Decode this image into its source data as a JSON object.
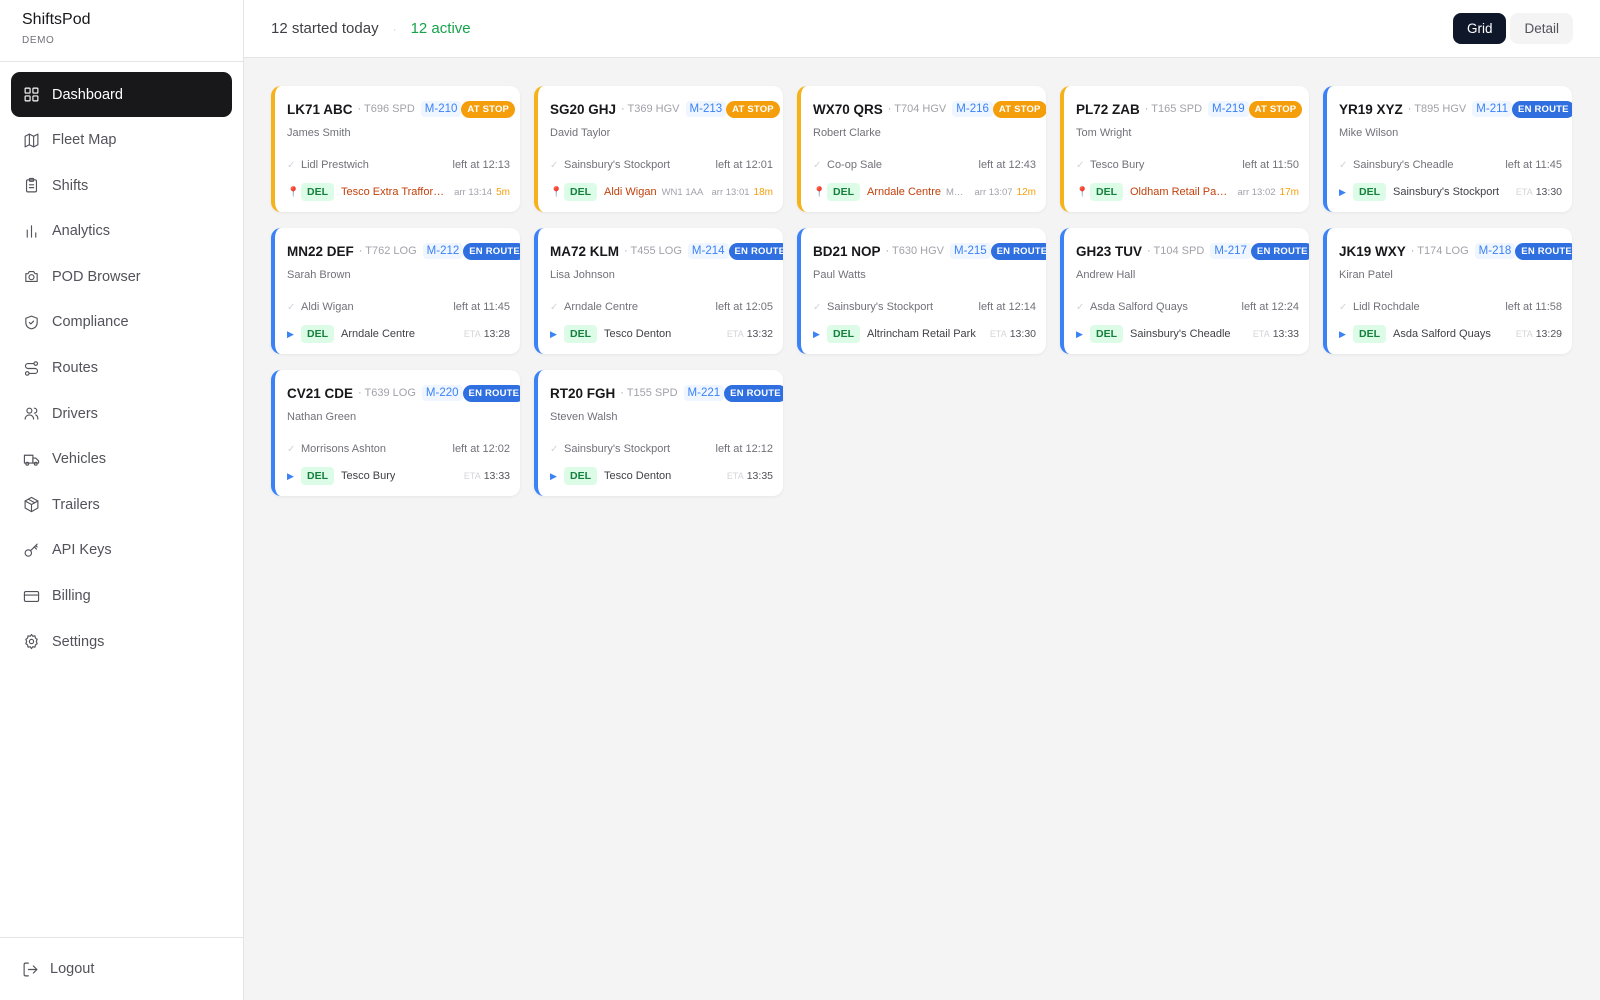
{
  "app": {
    "name": "ShiftsPod",
    "env": "DEMO"
  },
  "nav": {
    "items": [
      {
        "label": "Dashboard",
        "icon": "grid-icon"
      },
      {
        "label": "Fleet Map",
        "icon": "map-icon"
      },
      {
        "label": "Shifts",
        "icon": "clipboard-icon"
      },
      {
        "label": "Analytics",
        "icon": "bar-chart-icon"
      },
      {
        "label": "POD Browser",
        "icon": "camera-icon"
      },
      {
        "label": "Compliance",
        "icon": "shield-check-icon"
      },
      {
        "label": "Routes",
        "icon": "route-icon"
      },
      {
        "label": "Drivers",
        "icon": "users-icon"
      },
      {
        "label": "Vehicles",
        "icon": "truck-icon"
      },
      {
        "label": "Trailers",
        "icon": "box-icon"
      },
      {
        "label": "API Keys",
        "icon": "key-icon"
      },
      {
        "label": "Billing",
        "icon": "credit-card-icon"
      },
      {
        "label": "Settings",
        "icon": "gear-icon"
      }
    ],
    "active": "Dashboard",
    "logout": "Logout"
  },
  "header": {
    "started": "12 started today",
    "separator": "·",
    "active": "12 active",
    "view_grid": "Grid",
    "view_detail": "Detail",
    "selected_view": "Grid"
  },
  "labels": {
    "del": "DEL",
    "eta": "ETA",
    "arr_prefix": "arr"
  },
  "colors": {
    "at_stop": "#f59e0b",
    "en_route": "#2f6fe0",
    "del_badge": "#15803d",
    "active": "#16a34a"
  },
  "cards": [
    {
      "plate": "LK71 ABC",
      "trailer": "· T696 SPD",
      "mission": "M-210",
      "status": "AT STOP",
      "kind": "stop",
      "driver": "James Smith",
      "prev_stop": "Lidl Prestwich",
      "prev_left": "left at 12:13",
      "next_stop": "Tesco Extra Traffor…",
      "postcode": "",
      "arr": "arr 13:14",
      "wait": "5m",
      "eta": ""
    },
    {
      "plate": "SG20 GHJ",
      "trailer": "· T369 HGV",
      "mission": "M-213",
      "status": "AT STOP",
      "kind": "stop",
      "driver": "David Taylor",
      "prev_stop": "Sainsbury's Stockport",
      "prev_left": "left at 12:01",
      "next_stop": "Aldi Wigan",
      "postcode": "WN1 1AA",
      "arr": "arr 13:01",
      "wait": "18m",
      "eta": ""
    },
    {
      "plate": "WX70 QRS",
      "trailer": "· T704 HGV",
      "mission": "M-216",
      "status": "AT STOP",
      "kind": "stop",
      "driver": "Robert Clarke",
      "prev_stop": "Co-op Sale",
      "prev_left": "left at 12:43",
      "next_stop": "Arndale Centre",
      "postcode": "M…",
      "arr": "arr 13:07",
      "wait": "12m",
      "eta": ""
    },
    {
      "plate": "PL72 ZAB",
      "trailer": "· T165 SPD",
      "mission": "M-219",
      "status": "AT STOP",
      "kind": "stop",
      "driver": "Tom Wright",
      "prev_stop": "Tesco Bury",
      "prev_left": "left at 11:50",
      "next_stop": "Oldham Retail Pa…",
      "postcode": "",
      "arr": "arr 13:02",
      "wait": "17m",
      "eta": ""
    },
    {
      "plate": "YR19 XYZ",
      "trailer": "· T895 HGV",
      "mission": "M-211",
      "status": "EN ROUTE",
      "kind": "route",
      "driver": "Mike Wilson",
      "prev_stop": "Sainsbury's Cheadle",
      "prev_left": "left at 11:45",
      "next_stop": "Sainsbury's Stockport",
      "postcode": "",
      "arr": "",
      "wait": "",
      "eta": "13:30"
    },
    {
      "plate": "MN22 DEF",
      "trailer": "· T762 LOG",
      "mission": "M-212",
      "status": "EN ROUTE",
      "kind": "route",
      "driver": "Sarah Brown",
      "prev_stop": "Aldi Wigan",
      "prev_left": "left at 11:45",
      "next_stop": "Arndale Centre",
      "postcode": "",
      "arr": "",
      "wait": "",
      "eta": "13:28"
    },
    {
      "plate": "MA72 KLM",
      "trailer": "· T455 LOG",
      "mission": "M-214",
      "status": "EN ROUTE",
      "kind": "route",
      "driver": "Lisa Johnson",
      "prev_stop": "Arndale Centre",
      "prev_left": "left at 12:05",
      "next_stop": "Tesco Denton",
      "postcode": "",
      "arr": "",
      "wait": "",
      "eta": "13:32"
    },
    {
      "plate": "BD21 NOP",
      "trailer": "· T630 HGV",
      "mission": "M-215",
      "status": "EN ROUTE",
      "kind": "route",
      "driver": "Paul Watts",
      "prev_stop": "Sainsbury's Stockport",
      "prev_left": "left at 12:14",
      "next_stop": "Altrincham Retail Park",
      "postcode": "",
      "arr": "",
      "wait": "",
      "eta": "13:30"
    },
    {
      "plate": "GH23 TUV",
      "trailer": "· T104 SPD",
      "mission": "M-217",
      "status": "EN ROUTE",
      "kind": "route",
      "driver": "Andrew Hall",
      "prev_stop": "Asda Salford Quays",
      "prev_left": "left at 12:24",
      "next_stop": "Sainsbury's Cheadle",
      "postcode": "",
      "arr": "",
      "wait": "",
      "eta": "13:33"
    },
    {
      "plate": "JK19 WXY",
      "trailer": "· T174 LOG",
      "mission": "M-218",
      "status": "EN ROUTE",
      "kind": "route",
      "driver": "Kiran Patel",
      "prev_stop": "Lidl Rochdale",
      "prev_left": "left at 11:58",
      "next_stop": "Asda Salford Quays",
      "postcode": "",
      "arr": "",
      "wait": "",
      "eta": "13:29"
    },
    {
      "plate": "CV21 CDE",
      "trailer": "· T639 LOG",
      "mission": "M-220",
      "status": "EN ROUTE",
      "kind": "route",
      "driver": "Nathan Green",
      "prev_stop": "Morrisons Ashton",
      "prev_left": "left at 12:02",
      "next_stop": "Tesco Bury",
      "postcode": "",
      "arr": "",
      "wait": "",
      "eta": "13:33"
    },
    {
      "plate": "RT20 FGH",
      "trailer": "· T155 SPD",
      "mission": "M-221",
      "status": "EN ROUTE",
      "kind": "route",
      "driver": "Steven Walsh",
      "prev_stop": "Sainsbury's Stockport",
      "prev_left": "left at 12:12",
      "next_stop": "Tesco Denton",
      "postcode": "",
      "arr": "",
      "wait": "",
      "eta": "13:35"
    }
  ]
}
